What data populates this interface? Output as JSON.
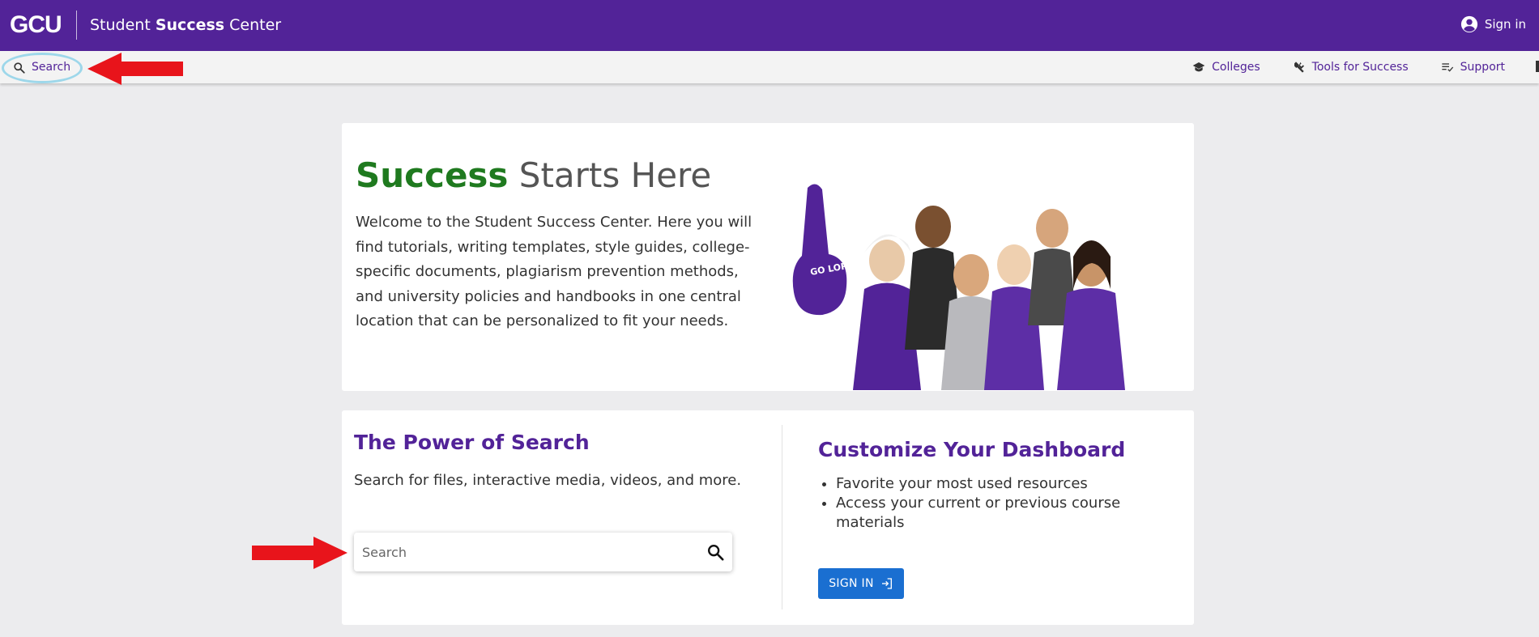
{
  "header": {
    "logo_text": "GCU",
    "title_pre": "Student ",
    "title_bold": "Success",
    "title_post": " Center",
    "sign_in": "Sign in"
  },
  "subnav": {
    "search_label": "Search",
    "items": [
      {
        "label": "Colleges",
        "icon": "graduation-cap-icon"
      },
      {
        "label": "Tools for Success",
        "icon": "tools-icon"
      },
      {
        "label": "Support",
        "icon": "checklist-icon"
      }
    ]
  },
  "hero": {
    "headline_green": "Success",
    "headline_rest": " Starts Here",
    "body": "Welcome to the Student Success Center. Here you will find tutorials, writing templates, style guides, college-specific documents, plagiarism prevention methods, and university policies and handbooks in one central location that can be personalized to fit your needs.",
    "foam_finger_text": "GO LOPES!"
  },
  "search_section": {
    "title": "The Power of Search",
    "description": "Search for files, interactive media, videos, and more.",
    "placeholder": "Search"
  },
  "dashboard_section": {
    "title": "Customize Your Dashboard",
    "bullets": [
      "Favorite your most used resources",
      "Access your current or previous course materials"
    ],
    "button_label": "SIGN IN"
  },
  "colors": {
    "brand_purple": "#522398",
    "accent_green": "#1f7a1f",
    "button_blue": "#1a6fd1",
    "annotation_red": "#e8141b",
    "annotation_ring": "#9dd7ea"
  }
}
